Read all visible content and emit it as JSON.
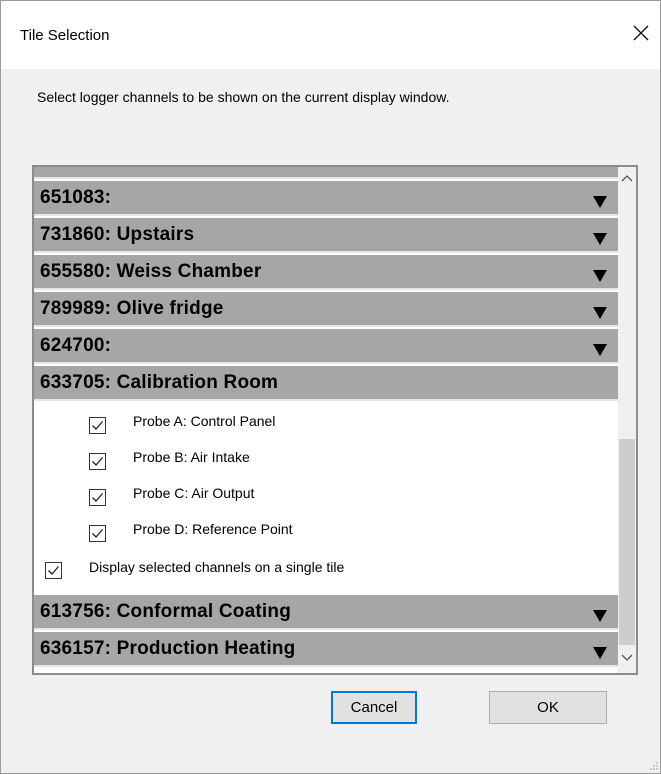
{
  "window": {
    "title": "Tile Selection",
    "close_glyph": "close-icon"
  },
  "instructions": "Select logger channels to be shown on the current display window.",
  "loggers": [
    {
      "label": "651083:",
      "expanded": false
    },
    {
      "label": "731860: Upstairs",
      "expanded": false
    },
    {
      "label": "655580: Weiss Chamber",
      "expanded": false
    },
    {
      "label": "789989: Olive fridge",
      "expanded": false
    },
    {
      "label": "624700:",
      "expanded": false
    },
    {
      "label": "633705: Calibration Room",
      "expanded": true
    },
    {
      "label": "613756: Conformal Coating",
      "expanded": false
    },
    {
      "label": "636157: Production Heating",
      "expanded": false
    }
  ],
  "probes": [
    {
      "label": "Probe A: Control Panel",
      "checked": true
    },
    {
      "label": "Probe B: Air Intake",
      "checked": true
    },
    {
      "label": "Probe C: Air Output",
      "checked": true
    },
    {
      "label": "Probe D: Reference Point",
      "checked": true
    }
  ],
  "single_tile": {
    "label": "Display selected channels on a single tile",
    "checked": true
  },
  "buttons": {
    "cancel": "Cancel",
    "ok": "OK"
  },
  "colors": {
    "header_bg": "#a6a6a6",
    "focus_border": "#0078d7"
  }
}
